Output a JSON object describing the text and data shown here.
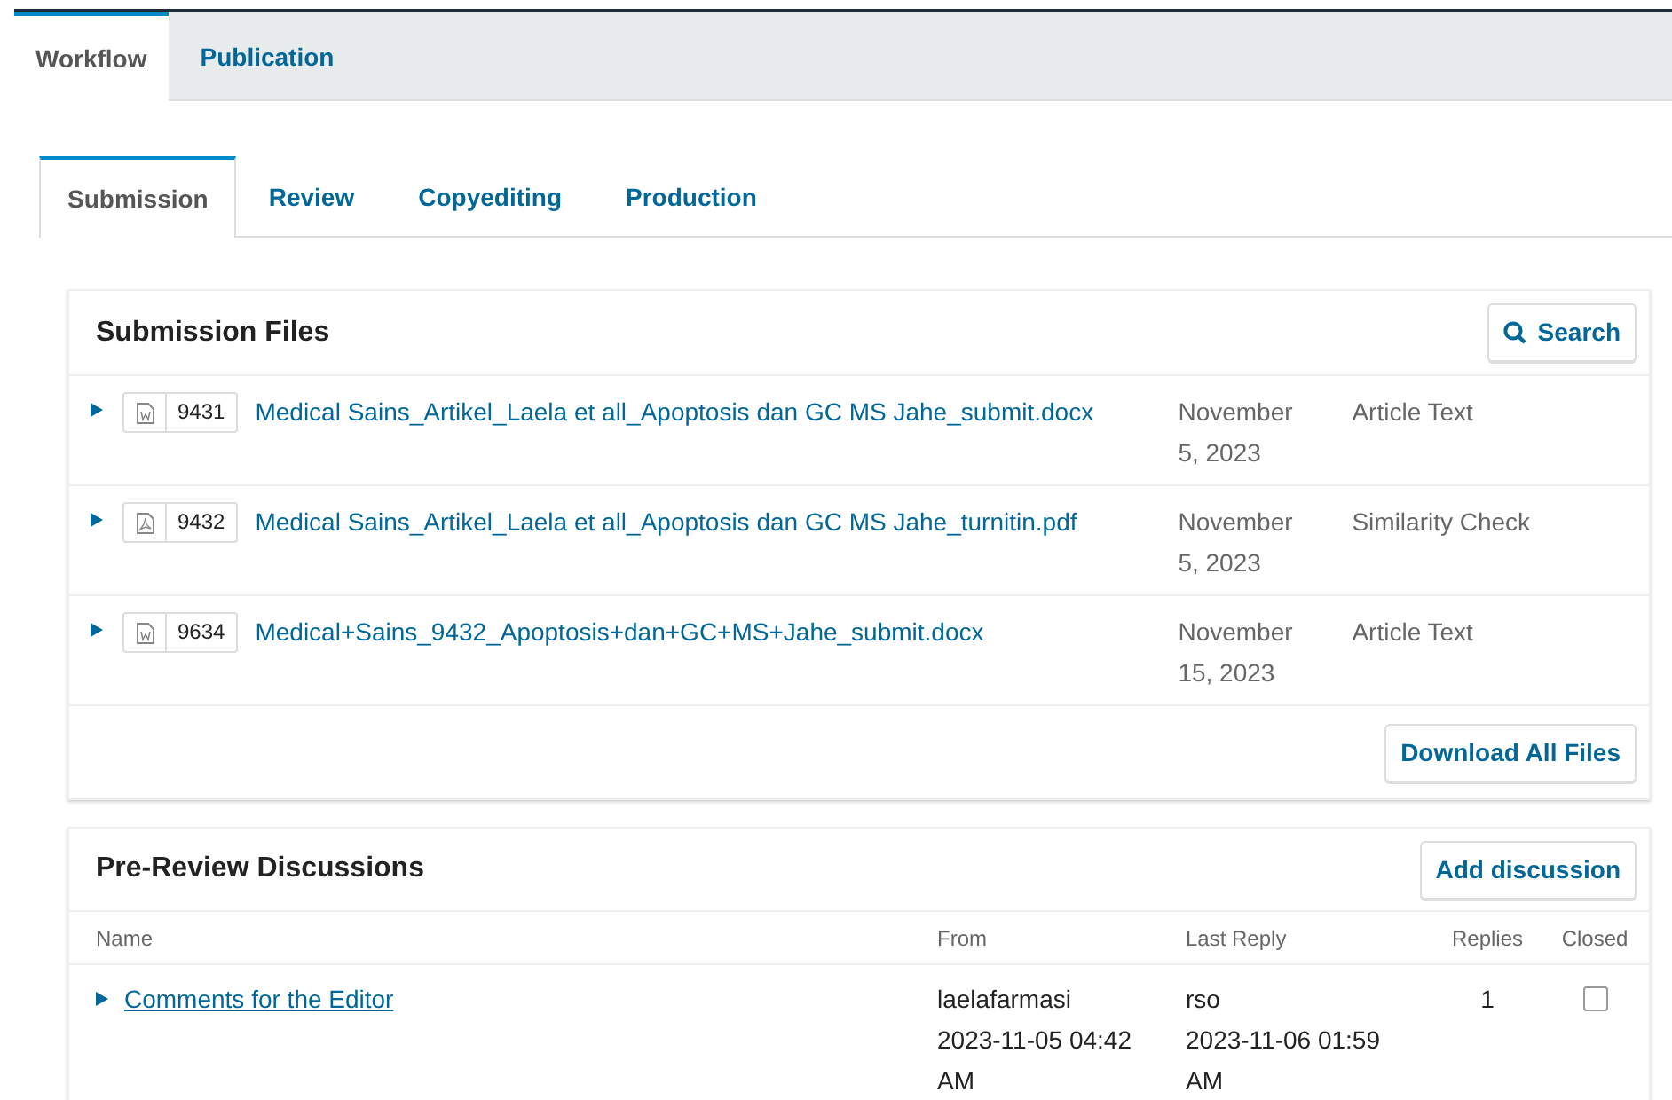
{
  "main_tabs": [
    {
      "label": "Workflow",
      "selected": true
    },
    {
      "label": "Publication",
      "selected": false
    }
  ],
  "stage_tabs": [
    {
      "label": "Submission",
      "selected": true
    },
    {
      "label": "Review",
      "selected": false
    },
    {
      "label": "Copyediting",
      "selected": false
    },
    {
      "label": "Production",
      "selected": false
    }
  ],
  "submission_files": {
    "title": "Submission Files",
    "search_button": "Search",
    "files": [
      {
        "kind": "word",
        "id": "9431",
        "name": "Medical Sains_Artikel_Laela et all_Apoptosis dan GC MS Jahe_submit.docx",
        "date": "November 5, 2023",
        "component": "Article Text"
      },
      {
        "kind": "pdf",
        "id": "9432",
        "name": "Medical Sains_Artikel_Laela et all_Apoptosis dan GC MS Jahe_turnitin.pdf",
        "date": "November 5, 2023",
        "component": "Similarity Check"
      },
      {
        "kind": "word",
        "id": "9634",
        "name": "Medical+Sains_9432_Apoptosis+dan+GC+MS+Jahe_submit.docx",
        "date": "November 15, 2023",
        "component": "Article Text"
      }
    ],
    "download_button": "Download All Files"
  },
  "discussions": {
    "title": "Pre-Review Discussions",
    "add_button": "Add discussion",
    "columns": [
      "Name",
      "From",
      "Last Reply",
      "Replies",
      "Closed"
    ],
    "rows": [
      {
        "name": "Comments for the Editor",
        "from": "laelafarmasi",
        "from_date": "2023-11-05 04:42 AM",
        "reply_by": "rso",
        "reply_date": "2023-11-06 01:59 AM",
        "replies": "1",
        "closed": false
      }
    ]
  }
}
